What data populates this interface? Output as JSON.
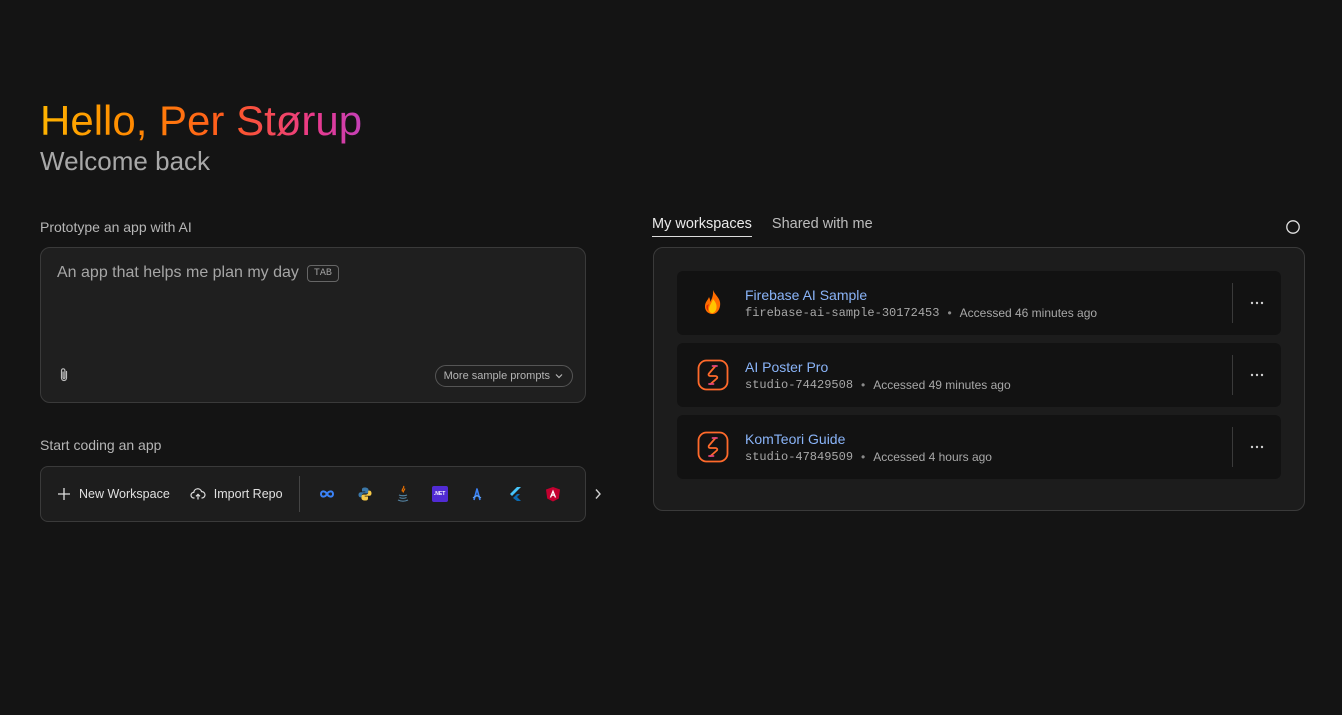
{
  "header": {
    "greeting": "Hello, Per Størup",
    "subtitle": "Welcome back"
  },
  "prototype": {
    "label": "Prototype an app with AI",
    "placeholder": "An app that helps me plan my day",
    "tab_hint": "TAB",
    "attach_icon": "paperclip-icon",
    "sample_prompts_label": "More sample prompts"
  },
  "coding": {
    "label": "Start coding an app",
    "new_workspace_label": "New Workspace",
    "import_repo_label": "Import Repo",
    "templates": [
      "infinity-icon",
      "python-icon",
      "java-icon",
      "dotnet-icon",
      "astro-icon",
      "flutter-icon",
      "angular-icon"
    ],
    "dotnet_text": ".NET"
  },
  "workspaces": {
    "tabs": [
      {
        "label": "My workspaces",
        "active": true
      },
      {
        "label": "Shared with me",
        "active": false
      }
    ],
    "items": [
      {
        "name": "Firebase AI Sample",
        "id": "firebase-ai-sample-30172453",
        "accessed": "Accessed 46 minutes ago",
        "icon": "firebase-icon"
      },
      {
        "name": "AI Poster Pro",
        "id": "studio-74429508",
        "accessed": "Accessed 49 minutes ago",
        "icon": "studio-icon"
      },
      {
        "name": "KomTeori Guide",
        "id": "studio-47849509",
        "accessed": "Accessed 4 hours ago",
        "icon": "studio-icon"
      }
    ],
    "separator": "•"
  },
  "colors": {
    "background": "#141414",
    "link": "#8ab4f8",
    "studio_orange": "#ff6a2b"
  }
}
